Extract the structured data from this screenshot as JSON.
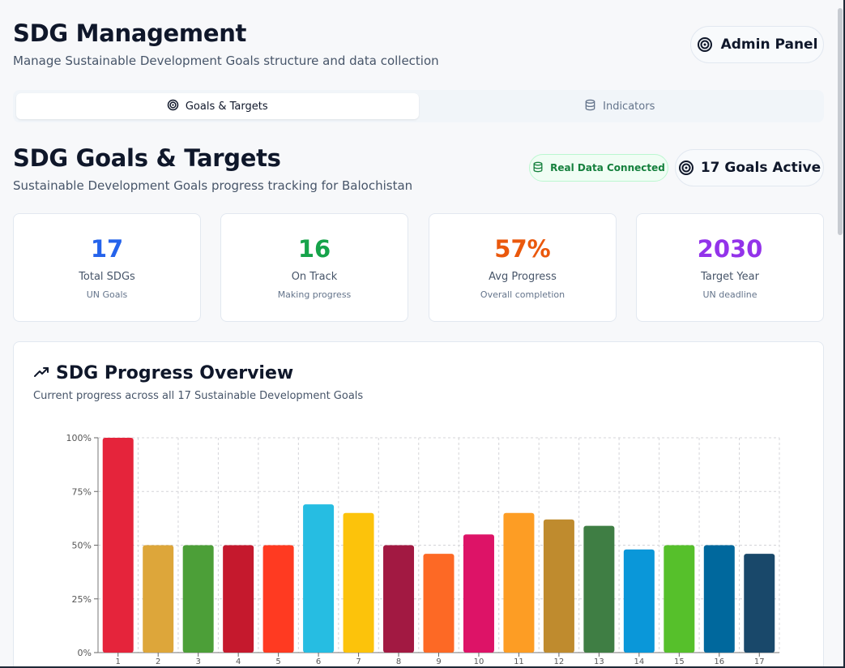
{
  "header": {
    "title": "SDG Management",
    "subtitle": "Manage Sustainable Development Goals structure and data collection",
    "admin_button": "Admin Panel"
  },
  "tabs": [
    {
      "label": "Goals & Targets",
      "icon": "target-icon",
      "active": true
    },
    {
      "label": "Indicators",
      "icon": "database-icon",
      "active": false
    }
  ],
  "section": {
    "title": "SDG Goals & Targets",
    "subtitle": "Sustainable Development Goals progress tracking for Balochistan",
    "badge_real_data": "Real Data Connected",
    "goals_active": "17 Goals Active"
  },
  "stats": [
    {
      "value": "17",
      "label": "Total SDGs",
      "sub": "UN Goals",
      "color": "#2563eb"
    },
    {
      "value": "16",
      "label": "On Track",
      "sub": "Making progress",
      "color": "#16a34a"
    },
    {
      "value": "57%",
      "label": "Avg Progress",
      "sub": "Overall completion",
      "color": "#ea580c"
    },
    {
      "value": "2030",
      "label": "Target Year",
      "sub": "UN deadline",
      "color": "#9333ea"
    }
  ],
  "chart": {
    "title": "SDG Progress Overview",
    "subtitle": "Current progress across all 17 Sustainable Development Goals"
  },
  "chart_data": {
    "type": "bar",
    "categories": [
      "1",
      "2",
      "3",
      "4",
      "5",
      "6",
      "7",
      "8",
      "9",
      "10",
      "11",
      "12",
      "13",
      "14",
      "15",
      "16",
      "17"
    ],
    "values": [
      100,
      50,
      50,
      50,
      50,
      69,
      65,
      50,
      46,
      55,
      65,
      62,
      59,
      48,
      50,
      50,
      46
    ],
    "colors": [
      "#e5243b",
      "#dda63a",
      "#4c9f38",
      "#c5192d",
      "#ff3a21",
      "#26bde2",
      "#fcc30b",
      "#a21942",
      "#fd6925",
      "#dd1367",
      "#fd9d24",
      "#bf8b2e",
      "#3f7e44",
      "#0a97d9",
      "#56c02b",
      "#00689d",
      "#19486a"
    ],
    "yticks": [
      "0%",
      "25%",
      "50%",
      "75%",
      "100%"
    ],
    "ylim": [
      0,
      100
    ],
    "grid": true
  }
}
